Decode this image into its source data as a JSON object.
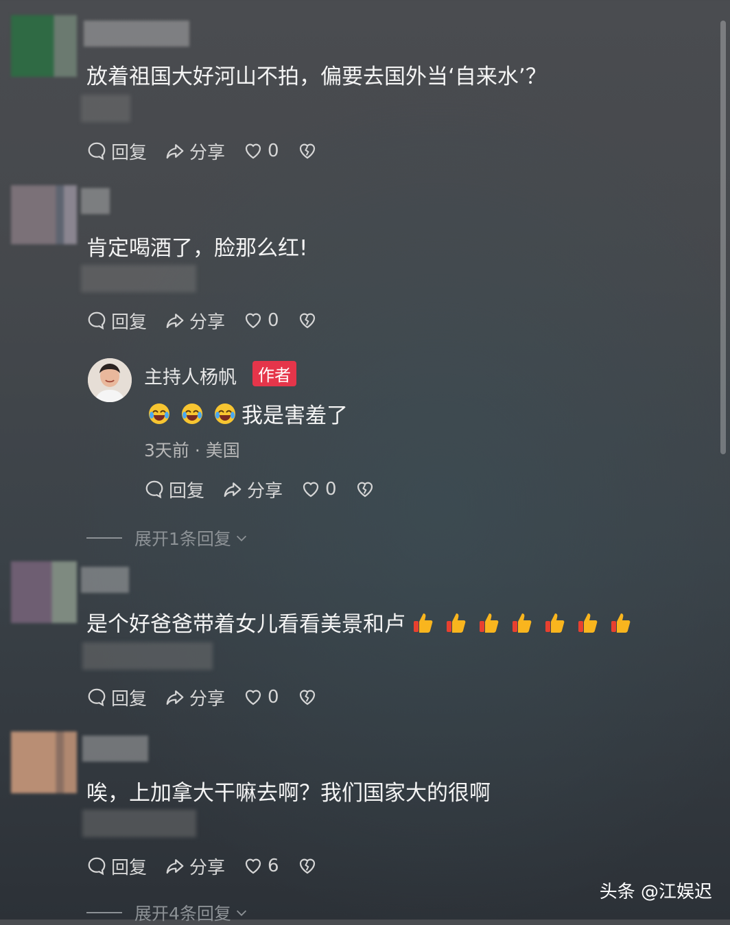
{
  "comments": [
    {
      "text": "放着祖国大好河山不拍，偏要去国外当‘自来水’？",
      "reply": "回复",
      "share": "分享",
      "likes": "0"
    },
    {
      "text": "肯定喝酒了，脸那么红!",
      "reply": "回复",
      "share": "分享",
      "likes": "0"
    },
    {
      "text": "是个好爸爸带着女儿看看美景和卢",
      "reply": "回复",
      "share": "分享",
      "likes": "0"
    },
    {
      "text": "唉，上加拿大干嘛去啊？我们国家大的很啊",
      "reply": "回复",
      "share": "分享",
      "likes": "6"
    }
  ],
  "author_reply": {
    "name": "主持人杨帆",
    "badge": "作者",
    "text": "我是害羞了",
    "meta": "3天前 · 美国",
    "reply": "回复",
    "share": "分享",
    "likes": "0"
  },
  "expand_1": "展开1条回复",
  "expand_4": "展开4条回复",
  "watermark": "头条 @江娱迟",
  "colors": {
    "badge": "#e5354a",
    "text": "#f4f4f4",
    "muted": "#d6d6d6"
  },
  "icons": [
    "comment-icon",
    "share-icon",
    "heart-icon",
    "broken-heart-icon",
    "laugh-cry-emoji",
    "thumbs-up-emoji",
    "chevron-down-icon"
  ]
}
